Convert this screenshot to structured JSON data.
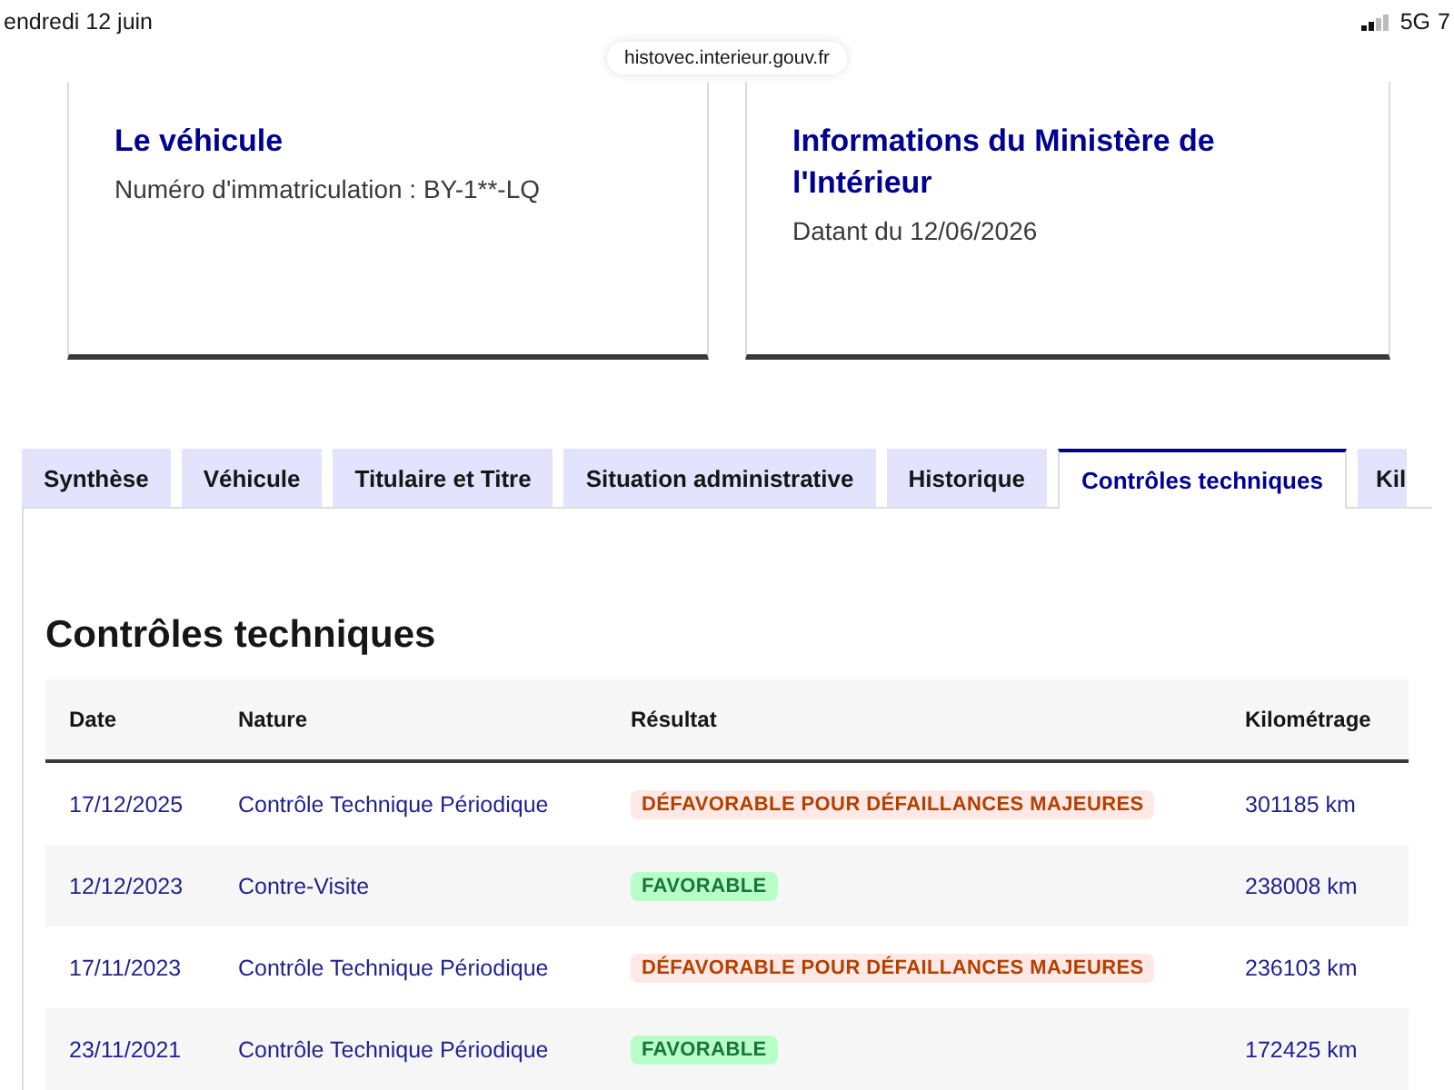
{
  "status_bar": {
    "date": "endredi 12 juin",
    "network": "5G",
    "battery": "7"
  },
  "address_bar": {
    "url": "histovec.interieur.gouv.fr"
  },
  "cards": [
    {
      "title": "Le véhicule",
      "text": "Numéro d'immatriculation : BY-1**-LQ"
    },
    {
      "title": "Informations du Ministère de l'Intérieur",
      "text": "Datant du 12/06/2026"
    }
  ],
  "tabs": [
    {
      "label": "Synthèse",
      "selected": false
    },
    {
      "label": "Véhicule",
      "selected": false
    },
    {
      "label": "Titulaire et Titre",
      "selected": false
    },
    {
      "label": "Situation administrative",
      "selected": false
    },
    {
      "label": "Historique",
      "selected": false
    },
    {
      "label": "Contrôles techniques",
      "selected": true
    },
    {
      "label": "Kil",
      "selected": false
    }
  ],
  "section": {
    "title": "Contrôles techniques",
    "table": {
      "columns": [
        "Date",
        "Nature",
        "Résultat",
        "Kilométrage"
      ],
      "rows": [
        {
          "date": "17/12/2025",
          "nature": "Contrôle Technique Périodique",
          "result": {
            "text": "DÉFAVORABLE POUR DÉFAILLANCES MAJEURES",
            "kind": "unfavorable"
          },
          "mileage": "301185 km"
        },
        {
          "date": "12/12/2023",
          "nature": "Contre-Visite",
          "result": {
            "text": "FAVORABLE",
            "kind": "favorable"
          },
          "mileage": "238008 km"
        },
        {
          "date": "17/11/2023",
          "nature": "Contrôle Technique Périodique",
          "result": {
            "text": "DÉFAVORABLE POUR DÉFAILLANCES MAJEURES",
            "kind": "unfavorable"
          },
          "mileage": "236103 km"
        },
        {
          "date": "23/11/2021",
          "nature": "Contrôle Technique Périodique",
          "result": {
            "text": "FAVORABLE",
            "kind": "favorable"
          },
          "mileage": "172425 km"
        }
      ]
    }
  }
}
